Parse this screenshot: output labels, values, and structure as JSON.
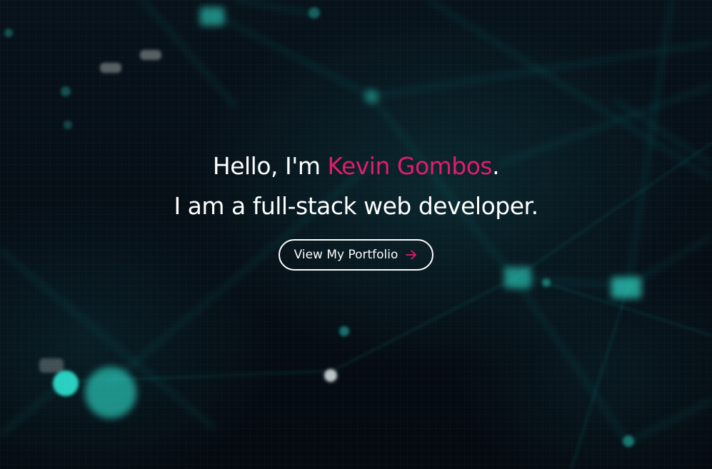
{
  "hero": {
    "greeting_prefix": "Hello, I'm ",
    "name": "Kevin Gombos",
    "greeting_suffix": ".",
    "tagline": "I am a full-stack web developer.",
    "cta_label": "View My Portfolio",
    "cta_icon": "arrow-right-icon"
  },
  "colors": {
    "accent": "#e31b6d",
    "text": "#ffffff",
    "background": "#060b12",
    "network_glow": "#2fe3d0"
  }
}
